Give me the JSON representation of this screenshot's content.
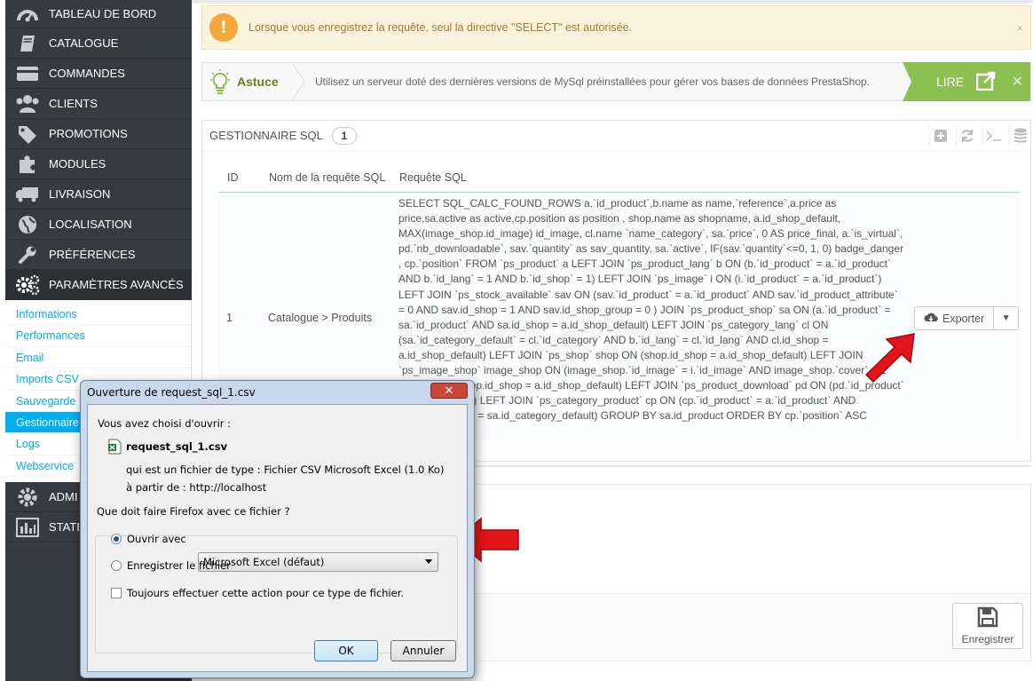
{
  "sidebar": {
    "items": [
      {
        "label": "TABLEAU DE BORD",
        "icon": "dashboard-icon"
      },
      {
        "label": "CATALOGUE",
        "icon": "book-icon"
      },
      {
        "label": "COMMANDES",
        "icon": "credit-card-icon"
      },
      {
        "label": "CLIENTS",
        "icon": "users-icon"
      },
      {
        "label": "PROMOTIONS",
        "icon": "tag-icon"
      },
      {
        "label": "MODULES",
        "icon": "puzzle-icon"
      },
      {
        "label": "LIVRAISON",
        "icon": "truck-icon"
      },
      {
        "label": "LOCALISATION",
        "icon": "globe-icon"
      },
      {
        "label": "PRÉFÉRENCES",
        "icon": "wrench-icon"
      },
      {
        "label": "PARAMÈTRES AVANCÉS",
        "icon": "cogs-icon"
      }
    ],
    "submenu": [
      "Informations",
      "Performances",
      "Email",
      "Imports CSV",
      "Sauvegarde",
      "Gestionnaire",
      "Logs",
      "Webservice"
    ],
    "bottom_items": [
      {
        "label": "ADMI",
        "icon": "gear-icon"
      },
      {
        "label": "STATIS",
        "icon": "bar-chart-icon"
      }
    ]
  },
  "alert": {
    "text": "Lorsque vous enregistrez la requête, seul la directive \"SELECT\" est autorisée.",
    "close": "×"
  },
  "tip": {
    "title": "Astuce",
    "text": "Utilisez un serveur doté des dernières versions de MySql préinstallées pour gérer vos bases de données PrestaShop.",
    "read_label": "LIRE",
    "close": "✕"
  },
  "panel": {
    "title": "GESTIONNAIRE SQL",
    "count": "1",
    "columns": [
      "ID",
      "Nom de la requête SQL",
      "Requête SQL"
    ],
    "row": {
      "id": "1",
      "name": "Catalogue > Produits",
      "sql": "SELECT SQL_CALC_FOUND_ROWS a.`id_product`,b.name as name,`reference`,a.price as price,sa.active as active,cp.position as position , shop.name as shopname, a.id_shop_default, MAX(image_shop.id_image) id_image, cl.name `name_category`, sa.`price`, 0 AS price_final, a.`is_virtual`, pd.`nb_downloadable`, sav.`quantity` as sav_quantity, sa.`active`, IF(sav.`quantity`<=0, 1, 0) badge_danger , cp.`position` FROM `ps_product` a LEFT JOIN `ps_product_lang` b ON (b.`id_product` = a.`id_product` AND b.`id_lang` = 1 AND b.`id_shop` = 1) LEFT JOIN `ps_image` i ON (i.`id_product` = a.`id_product`) LEFT JOIN `ps_stock_available` sav ON (sav.`id_product` = a.`id_product` AND sav.`id_product_attribute` = 0 AND sav.id_shop = 1 AND sav.id_shop_group = 0 ) JOIN `ps_product_shop` sa ON (a.`id_product` = sa.`id_product` AND sa.id_shop = a.id_shop_default) LEFT JOIN `ps_category_lang` cl ON (sa.`id_category_default` = cl.`id_category` AND b.`id_lang` = cl.`id_lang` AND cl.id_shop = a.id_shop_default) LEFT JOIN `ps_shop` shop ON (shop.id_shop = a.id_shop_default) LEFT JOIN `ps_image_shop` image_shop ON (image_shop.`id_image` = i.`id_image` AND image_shop.`cover` = 1 AND image_shop.id_shop = a.id_shop_default) LEFT JOIN `ps_product_download` pd ON (pd.`id_product` = a.`id_product`) LEFT JOIN `ps_category_product` cp ON (cp.`id_product` = a.`id_product` AND cp.`id_category` = sa.id_category_default) GROUP BY sa.id_product ORDER BY cp.`position` ASC",
      "export_label": "Exporter"
    }
  },
  "save_label": "Enregistrer",
  "dialog": {
    "title": "Ouverture de request_sql_1.csv",
    "intro": "Vous avez choisi d'ouvrir :",
    "filename": "request_sql_1.csv",
    "filetype": "qui est un fichier de type :  Fichier CSV Microsoft Excel (1.0 Ko)",
    "source": "à partir de :  http://localhost",
    "question": "Que doit faire Firefox avec ce fichier ?",
    "open_with": "Ouvrir avec",
    "app": "Microsoft Excel (défaut)",
    "save_file": "Enregistrer le fichier",
    "always": "Toujours effectuer cette action pour ce type de fichier.",
    "ok": "OK",
    "cancel": "Annuler"
  },
  "colors": {
    "sidebar_bg": "#363a41",
    "accent_blue": "#00aff0",
    "tip_green": "#8cc152",
    "alert_orange": "#f4a83c",
    "arrow_red": "#e4141b"
  }
}
